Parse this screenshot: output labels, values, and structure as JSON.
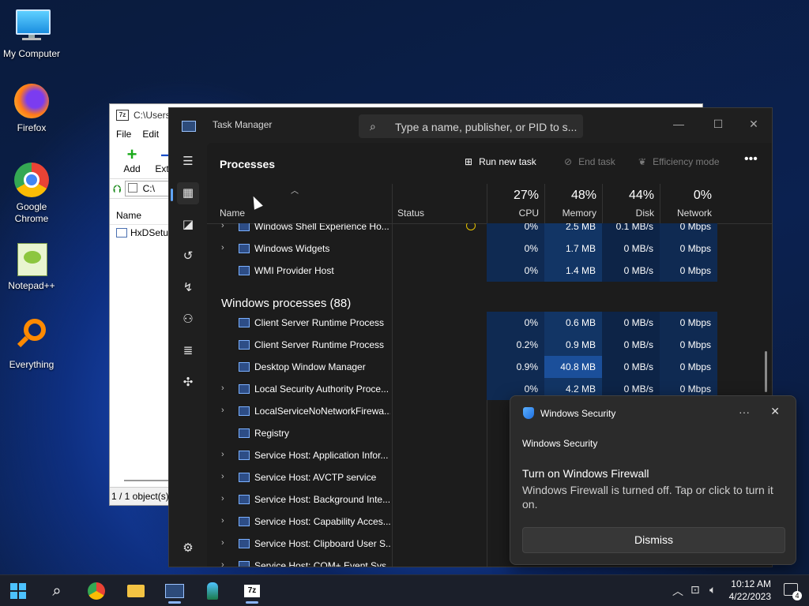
{
  "desktop": {
    "icons": [
      {
        "label": "My Computer"
      },
      {
        "label": "Firefox"
      },
      {
        "label": "Google Chrome"
      },
      {
        "label": "Notepad++"
      },
      {
        "label": "Everything"
      }
    ]
  },
  "sevenzip": {
    "title": "C:\\Users",
    "menu": [
      "File",
      "Edit"
    ],
    "tools": [
      "Add",
      "Extract"
    ],
    "address": "C:\\",
    "column_name": "Name",
    "file": "HxDSetup",
    "status": "1 / 1 object(s)"
  },
  "taskmanager": {
    "title": "Task Manager",
    "search_placeholder": "Type a name, publisher, or PID to s...",
    "page_title": "Processes",
    "run_new_task": "Run new task",
    "end_task": "End task",
    "efficiency_mode": "Efficiency mode",
    "columns": {
      "name": "Name",
      "status": "Status",
      "cpu": {
        "pct": "27%",
        "label": "CPU"
      },
      "memory": {
        "pct": "48%",
        "label": "Memory"
      },
      "disk": {
        "pct": "44%",
        "label": "Disk"
      },
      "network": {
        "pct": "0%",
        "label": "Network"
      }
    },
    "rows": [
      {
        "name": "Windows Shell Experience Ho...",
        "expand": true,
        "cpu": "0%",
        "mem": "2.5 MB",
        "disk": "0.1 MB/s",
        "net": "0 Mbps",
        "status_icon": true
      },
      {
        "name": "Windows Widgets",
        "expand": true,
        "cpu": "0%",
        "mem": "1.7 MB",
        "disk": "0 MB/s",
        "net": "0 Mbps"
      },
      {
        "name": "WMI Provider Host",
        "expand": false,
        "cpu": "0%",
        "mem": "1.4 MB",
        "disk": "0 MB/s",
        "net": "0 Mbps"
      }
    ],
    "group": "Windows processes (88)",
    "group_rows": [
      {
        "name": "Client Server Runtime Process",
        "expand": false,
        "cpu": "0%",
        "mem": "0.6 MB",
        "disk": "0 MB/s",
        "net": "0 Mbps"
      },
      {
        "name": "Client Server Runtime Process",
        "expand": false,
        "cpu": "0.2%",
        "mem": "0.9 MB",
        "disk": "0 MB/s",
        "net": "0 Mbps"
      },
      {
        "name": "Desktop Window Manager",
        "expand": false,
        "cpu": "0.9%",
        "mem": "40.8 MB",
        "disk": "0 MB/s",
        "net": "0 Mbps",
        "mem_hi": true
      },
      {
        "name": "Local Security Authority Proce...",
        "expand": true,
        "cpu": "0%",
        "mem": "4.2 MB",
        "disk": "0 MB/s",
        "net": "0 Mbps"
      },
      {
        "name": "LocalServiceNoNetworkFirewa...",
        "expand": true
      },
      {
        "name": "Registry",
        "expand": false
      },
      {
        "name": "Service Host: Application Infor...",
        "expand": true
      },
      {
        "name": "Service Host: AVCTP service",
        "expand": true
      },
      {
        "name": "Service Host: Background Inte...",
        "expand": true
      },
      {
        "name": "Service Host: Capability Acces...",
        "expand": true
      },
      {
        "name": "Service Host: Clipboard User S...",
        "expand": true
      },
      {
        "name": "Service Host: COM+ Event Sys...",
        "expand": true
      }
    ]
  },
  "toast": {
    "header": "Windows Security",
    "app": "Windows Security",
    "title": "Turn on Windows Firewall",
    "body": "Windows Firewall is turned off. Tap or click to turn it on.",
    "dismiss": "Dismiss"
  },
  "taskbar": {
    "time": "10:12 AM",
    "date": "4/22/2023",
    "notification_count": "4"
  },
  "colors": {
    "accent": "#60a5fa",
    "cpu_col": "#0f2a52",
    "mem_col": "#123565",
    "disk_col": "#0d2447",
    "mem_hi": "#1b4f9a"
  }
}
